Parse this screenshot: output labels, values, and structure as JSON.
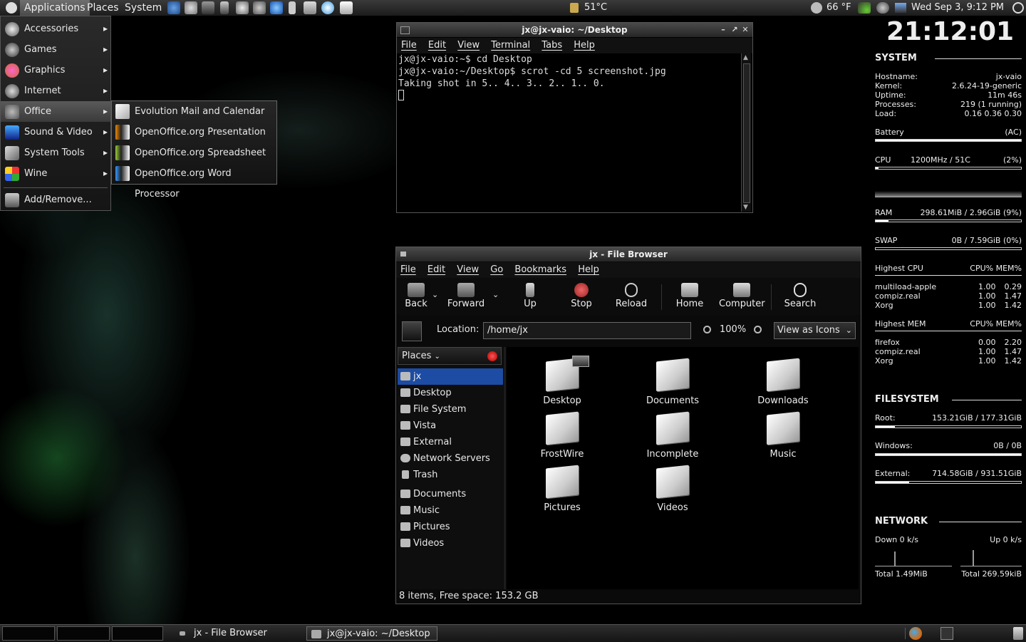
{
  "top_panel": {
    "menus": [
      "Applications",
      "Places",
      "System"
    ],
    "temperature": "51°C",
    "weather": "66 °F",
    "clock": "Wed Sep  3,  9:12 PM"
  },
  "app_menu": {
    "items": [
      {
        "label": "Accessories",
        "icon": "accessories-icon"
      },
      {
        "label": "Games",
        "icon": "games-icon"
      },
      {
        "label": "Graphics",
        "icon": "graphics-icon"
      },
      {
        "label": "Internet",
        "icon": "internet-icon"
      },
      {
        "label": "Office",
        "icon": "office-icon"
      },
      {
        "label": "Sound & Video",
        "icon": "sound-video-icon"
      },
      {
        "label": "System Tools",
        "icon": "system-tools-icon"
      },
      {
        "label": "Wine",
        "icon": "wine-icon"
      }
    ],
    "add_remove": "Add/Remove..."
  },
  "office_submenu": {
    "items": [
      "Evolution Mail and Calendar",
      "OpenOffice.org Presentation",
      "OpenOffice.org Spreadsheet",
      "OpenOffice.org Word Processor"
    ]
  },
  "terminal": {
    "title": "jx@jx-vaio: ~/Desktop",
    "menu": [
      "File",
      "Edit",
      "View",
      "Terminal",
      "Tabs",
      "Help"
    ],
    "lines": [
      "jx@jx-vaio:~$ cd Desktop",
      "jx@jx-vaio:~/Desktop$ scrot -cd 5 screenshot.jpg",
      "Taking shot in 5.. 4.. 3.. 2.. 1.. 0."
    ]
  },
  "file_browser": {
    "title": "jx - File Browser",
    "menu": [
      "File",
      "Edit",
      "View",
      "Go",
      "Bookmarks",
      "Help"
    ],
    "toolbar": {
      "back": "Back",
      "forward": "Forward",
      "up": "Up",
      "stop": "Stop",
      "reload": "Reload",
      "home": "Home",
      "computer": "Computer",
      "search": "Search"
    },
    "location_label": "Location:",
    "location_value": "/home/jx",
    "zoom": "100%",
    "view_mode": "View as Icons",
    "places_label": "Places",
    "places": [
      "jx",
      "Desktop",
      "File System",
      "Vista",
      "External",
      "Network Servers",
      "Trash"
    ],
    "bookmarks": [
      "Documents",
      "Music",
      "Pictures",
      "Videos"
    ],
    "items": [
      "Desktop",
      "Documents",
      "Downloads",
      "FrostWire",
      "Incomplete",
      "Music",
      "Pictures",
      "Videos"
    ],
    "status": "8 items, Free space: 153.2 GB"
  },
  "conky": {
    "time": "21:12:01",
    "system_header": "SYSTEM",
    "hostname_label": "Hostname:",
    "hostname": "jx-vaio",
    "kernel_label": "Kernel:",
    "kernel": "2.6.24-19-generic",
    "uptime_label": "Uptime:",
    "uptime": "11m 46s",
    "processes_label": "Processes:",
    "processes": "219 (1 running)",
    "load_label": "Load:",
    "load": "0.16 0.36 0.30",
    "battery_label": "Battery",
    "battery": "(AC)",
    "battery_fraction": 1.0,
    "cpu_label": "CPU",
    "cpu_freq": "1200MHz / 51C",
    "cpu_pct": "(2%)",
    "cpu_fraction": 0.02,
    "ram_label": "RAM",
    "ram": "298.61MiB / 2.96GiB (9%)",
    "ram_fraction": 0.09,
    "swap_label": "SWAP",
    "swap": "0B / 7.59GiB (0%)",
    "swap_fraction": 0.0,
    "highest_cpu_label": "Highest CPU",
    "highest_cpu_cols": "CPU% MEM%",
    "highest_cpu": [
      {
        "name": "multiload-apple",
        "cpu": "1.00",
        "mem": "0.29"
      },
      {
        "name": "compiz.real",
        "cpu": "1.00",
        "mem": "1.47"
      },
      {
        "name": "Xorg",
        "cpu": "1.00",
        "mem": "1.42"
      }
    ],
    "highest_mem_label": "Highest MEM",
    "highest_mem_cols": "CPU% MEM%",
    "highest_mem": [
      {
        "name": "firefox",
        "cpu": "0.00",
        "mem": "2.20"
      },
      {
        "name": "compiz.real",
        "cpu": "1.00",
        "mem": "1.47"
      },
      {
        "name": "Xorg",
        "cpu": "1.00",
        "mem": "1.42"
      }
    ],
    "fs_header": "FILESYSTEM",
    "root_label": "Root:",
    "root": "153.21GiB / 177.31GiB",
    "root_fraction": 0.13,
    "windows_label": "Windows:",
    "windows": "0B / 0B",
    "windows_fraction": 1.0,
    "external_label": "External:",
    "external": "714.58GiB / 931.51GiB",
    "external_fraction": 0.23,
    "net_header": "NETWORK",
    "down": "Down 0 k/s",
    "up": "Up 0 k/s",
    "total_down": "Total 1.49MiB",
    "total_up": "Total 269.59kiB"
  },
  "taskbar": {
    "tasks": [
      "jx - File Browser",
      "jx@jx-vaio: ~/Desktop"
    ]
  }
}
